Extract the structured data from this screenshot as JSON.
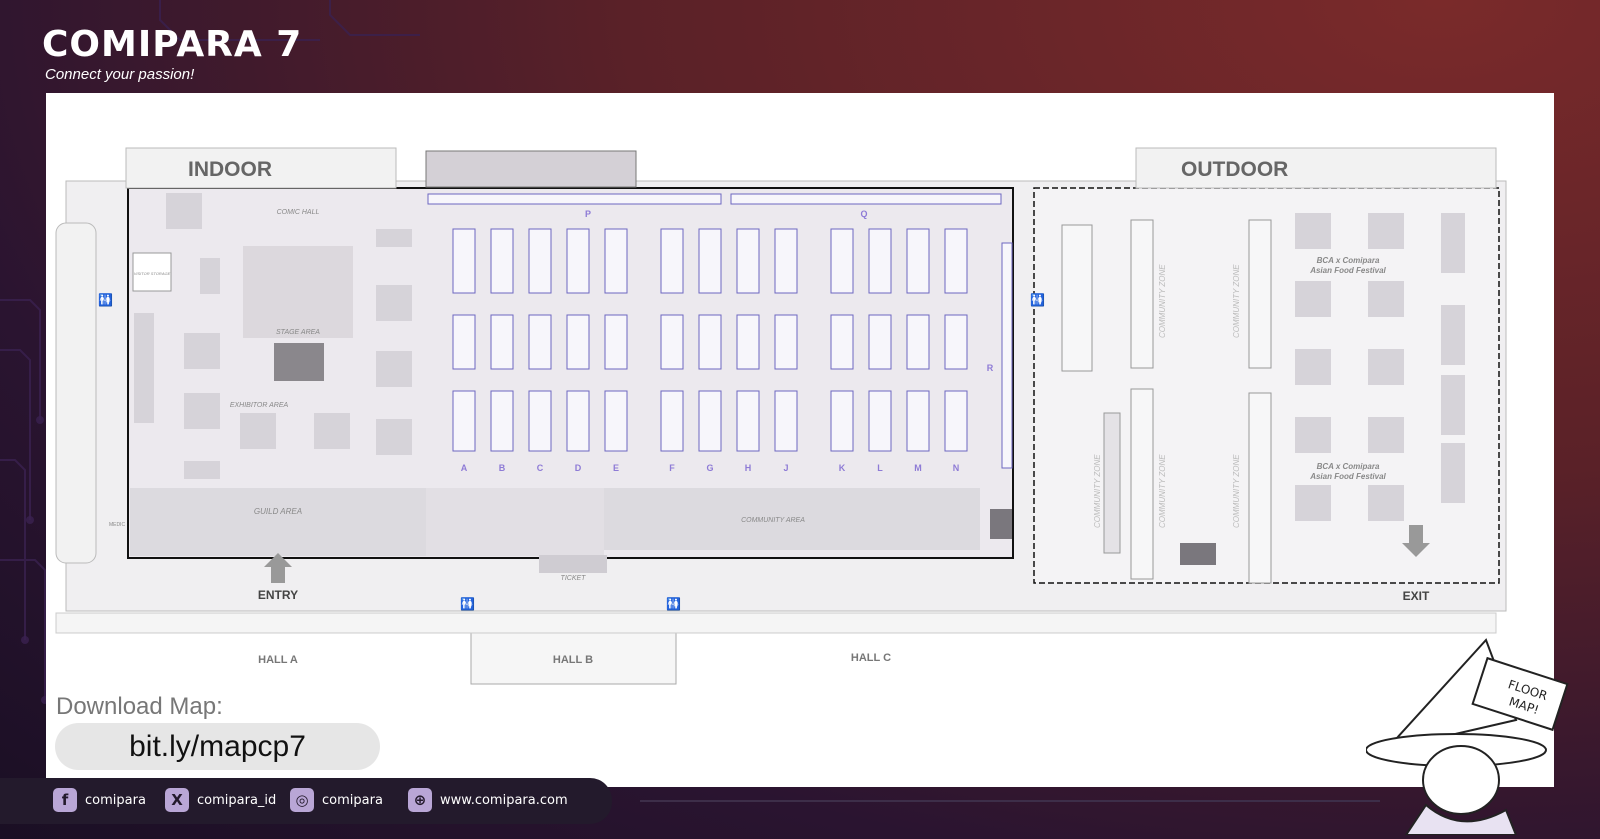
{
  "header": {
    "title": "COMIPARA 7",
    "tagline": "Connect your passion!"
  },
  "map": {
    "zones": {
      "indoor": "INDOOR",
      "outdoor": "OUTDOOR"
    },
    "areas": {
      "comic_hall": "COMIC HALL",
      "stage_area": "STAGE AREA",
      "exhibitor_area": "EXHIBITOR AREA",
      "visitor_storage": "VISITOR STORAGE",
      "guild_area": "GUILD AREA",
      "community_area": "COMMUNITY AREA",
      "ticket": "TICKET",
      "medic": "MEDIC",
      "entry": "ENTRY",
      "exit": "EXIT",
      "community_zone": "COMMUNITY ZONE",
      "food_festival_1": "BCA x Comipara",
      "food_festival_2": "Asian Food Festival"
    },
    "halls": {
      "a": "HALL A",
      "b": "HALL B",
      "c": "HALL C"
    },
    "row_letters": [
      "A",
      "B",
      "C",
      "D",
      "E",
      "F",
      "G",
      "H",
      "J",
      "K",
      "L",
      "M",
      "N"
    ],
    "top_row_letters": [
      "P",
      "Q"
    ],
    "side_row_letter": "R"
  },
  "download": {
    "label": "Download Map:",
    "url": "bit.ly/mapcp7"
  },
  "socials": [
    {
      "icon": "facebook-icon",
      "glyph": "f",
      "handle": "comipara"
    },
    {
      "icon": "x-icon",
      "glyph": "X",
      "handle": "comipara_id"
    },
    {
      "icon": "instagram-icon",
      "glyph": "◎",
      "handle": "comipara"
    },
    {
      "icon": "globe-icon",
      "glyph": "⊕",
      "handle": "www.comipara.com"
    }
  ],
  "mascot": {
    "sign_text_1": "FLOOR",
    "sign_text_2": "MAP!"
  },
  "colors": {
    "accent": "#8e7bd6",
    "booth_blue": "#5a56b0",
    "panel": "#ffffff"
  }
}
